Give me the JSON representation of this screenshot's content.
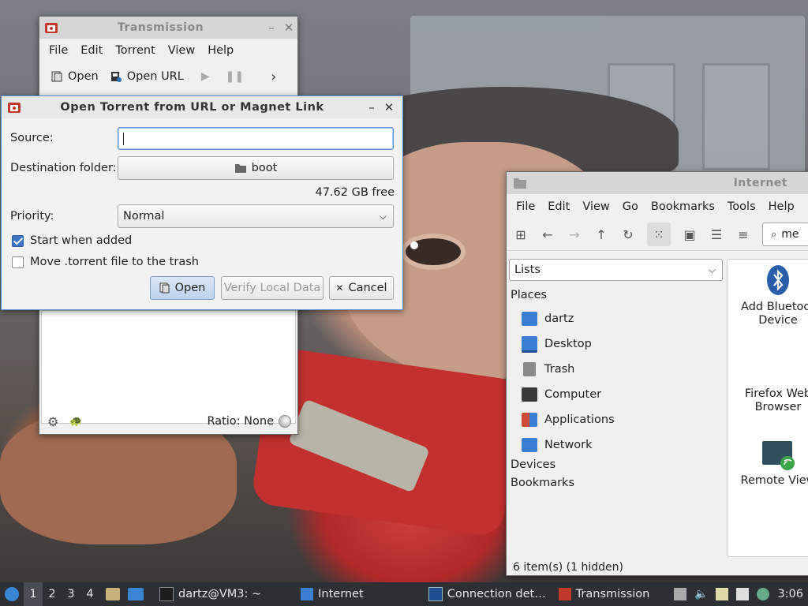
{
  "transmission": {
    "title": "Transmission",
    "menu": [
      "File",
      "Edit",
      "Torrent",
      "View",
      "Help"
    ],
    "toolbar": {
      "open": "Open",
      "open_url": "Open URL"
    },
    "status": {
      "ratio": "Ratio: None"
    }
  },
  "dialog": {
    "title": "Open Torrent from URL or Magnet Link",
    "source_label": "Source:",
    "source_value": "",
    "destination_label": "Destination folder:",
    "destination_value": "boot",
    "free_space": "47.62 GB free",
    "priority_label": "Priority:",
    "priority_value": "Normal",
    "start_when_added": {
      "label": "Start when added",
      "checked": true
    },
    "move_to_trash": {
      "label": "Move .torrent file to the trash",
      "checked": false
    },
    "buttons": {
      "open": "Open",
      "verify": "Verify Local Data",
      "cancel": "Cancel"
    }
  },
  "file_manager": {
    "title": "Internet",
    "menu": [
      "File",
      "Edit",
      "View",
      "Go",
      "Bookmarks",
      "Tools",
      "Help"
    ],
    "location_text": "me",
    "side_pane_mode": "Lists",
    "places_header": "Places",
    "places": [
      {
        "label": "dartz",
        "icon": "home-folder-icon",
        "color": "#3b7fd4"
      },
      {
        "label": "Desktop",
        "icon": "desktop-icon",
        "color": "#3b7fd4"
      },
      {
        "label": "Trash",
        "icon": "trash-icon",
        "color": "#8a8a8a"
      },
      {
        "label": "Computer",
        "icon": "computer-icon",
        "color": "#3a3a3a"
      },
      {
        "label": "Applications",
        "icon": "applications-icon",
        "color": "#d04a3a"
      },
      {
        "label": "Network",
        "icon": "network-folder-icon",
        "color": "#3b7fd4"
      }
    ],
    "devices_header": "Devices",
    "bookmarks_header": "Bookmarks",
    "items": [
      {
        "line1": "Add Bluetoot",
        "line2": "Device",
        "icon": "bluetooth-icon"
      },
      {
        "line1": "Firefox Web",
        "line2": "Browser",
        "icon": "firefox-icon"
      },
      {
        "line1": "Remote View",
        "line2": "",
        "icon": "remote-viewer-icon"
      }
    ],
    "status": "6 item(s) (1 hidden)"
  },
  "taskbar": {
    "workspaces": [
      "1",
      "2",
      "3",
      "4"
    ],
    "active_workspace": "1",
    "tasks": [
      {
        "label": "dartz@VM3: ~",
        "icon": "terminal-icon"
      },
      {
        "label": "Internet",
        "icon": "folder-icon"
      },
      {
        "label": "Connection det…",
        "icon": "monitor-icon"
      },
      {
        "label": "Transmission",
        "icon": "transmission-icon"
      }
    ],
    "clock": "3:06"
  }
}
